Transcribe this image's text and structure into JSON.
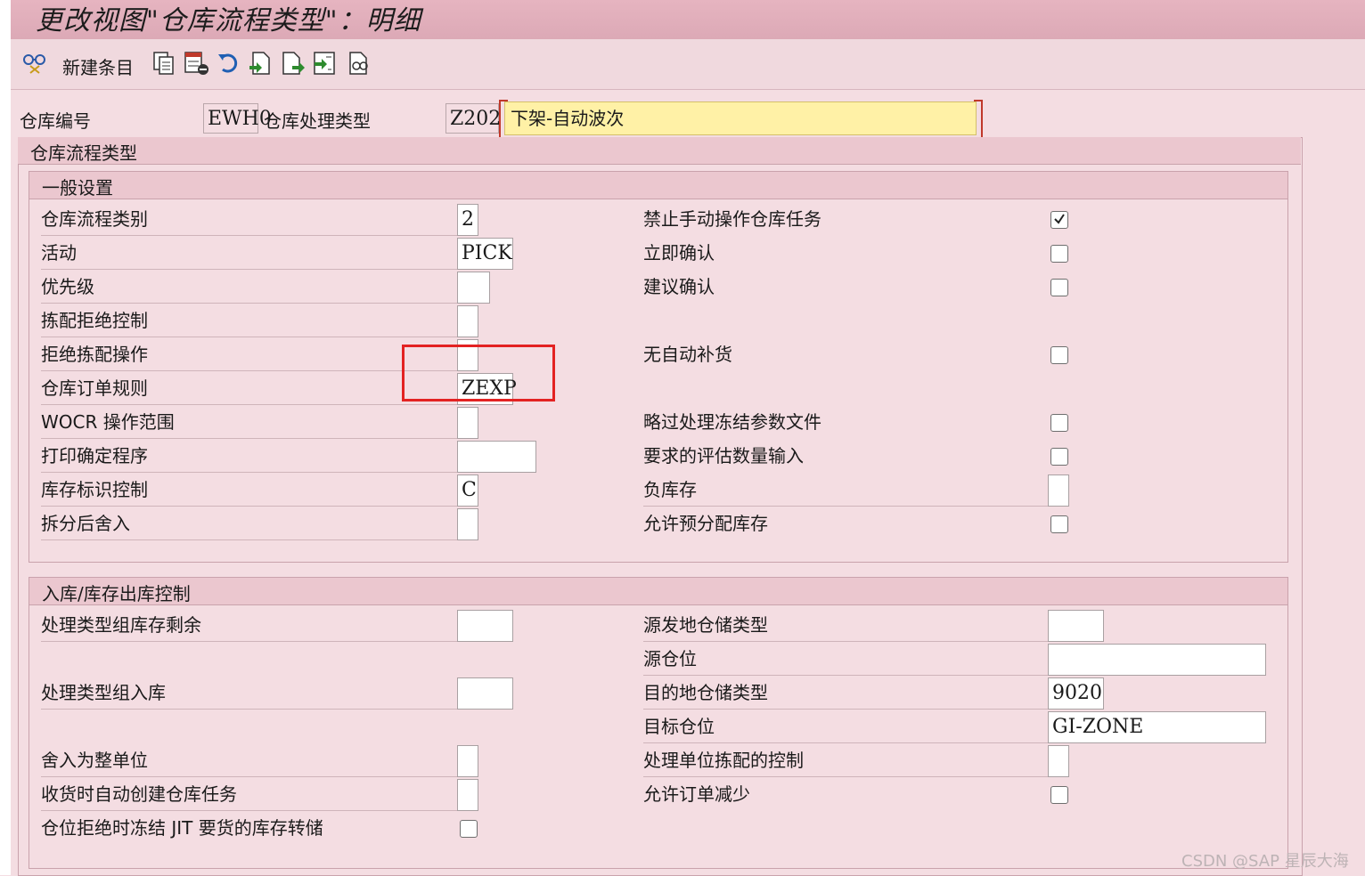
{
  "title": "更改视图\"仓库流程类型\"：明细",
  "toolbar": {
    "new_entries_label": "新建条目",
    "icons": [
      "glasses-icon",
      "copy-icon",
      "delete-icon",
      "undo-icon",
      "select-all-icon",
      "select-block-icon",
      "deselect-all-icon",
      "print-icon"
    ]
  },
  "header": {
    "warehouse_label": "仓库编号",
    "warehouse_value": "EWH0",
    "process_type_label": "仓库处理类型",
    "process_type_value": "Z202",
    "process_type_desc": "下架-自动波次"
  },
  "outer_section_title": "仓库流程类型",
  "general": {
    "title": "一般设置",
    "left_rows": [
      {
        "label": "仓库流程类别",
        "value": "2"
      },
      {
        "label": "活动",
        "value": "PICK"
      },
      {
        "label": "优先级",
        "value": ""
      },
      {
        "label": "拣配拒绝控制",
        "value": ""
      },
      {
        "label": "拒绝拣配操作",
        "value": ""
      },
      {
        "label": "仓库订单规则",
        "value": "ZEXP"
      },
      {
        "label": "WOCR 操作范围",
        "value": ""
      },
      {
        "label": "打印确定程序",
        "value": ""
      },
      {
        "label": "库存标识控制",
        "value": "C"
      },
      {
        "label": "拆分后舍入",
        "value": ""
      }
    ],
    "right_rows": [
      {
        "label": "禁止手动操作仓库任务",
        "checked": true
      },
      {
        "label": "立即确认",
        "checked": false
      },
      {
        "label": "建议确认",
        "checked": false
      },
      {
        "label": "无自动补货",
        "checked": false
      },
      {
        "label": "略过处理冻结参数文件",
        "checked": false
      },
      {
        "label": "要求的评估数量输入",
        "checked": false
      },
      {
        "label": "负库存",
        "value": ""
      },
      {
        "label": "允许预分配库存",
        "checked": false
      }
    ]
  },
  "inbound": {
    "title": "入库/库存出库控制",
    "left_rows": [
      {
        "label": "处理类型组库存剩余",
        "value": ""
      },
      {
        "label": "处理类型组入库",
        "value": ""
      },
      {
        "label": "舍入为整单位",
        "value": ""
      },
      {
        "label": "收货时自动创建仓库任务",
        "value": ""
      },
      {
        "label": "仓位拒绝时冻结 JIT 要货的库存转储",
        "checked": false
      }
    ],
    "right_rows": [
      {
        "label": "源发地仓储类型",
        "value": ""
      },
      {
        "label": "源仓位",
        "value": ""
      },
      {
        "label": "目的地仓储类型",
        "value": "9020"
      },
      {
        "label": "目标仓位",
        "value": "GI-ZONE"
      },
      {
        "label": "处理单位拣配的控制",
        "value": ""
      },
      {
        "label": "允许订单减少",
        "checked": false
      }
    ]
  },
  "watermark": "CSDN @SAP 星辰大海",
  "colors": {
    "background": "#f4dde2",
    "title_bar": "#dca9b6",
    "highlight": "#fff1a6",
    "annotation": "#e32222"
  }
}
